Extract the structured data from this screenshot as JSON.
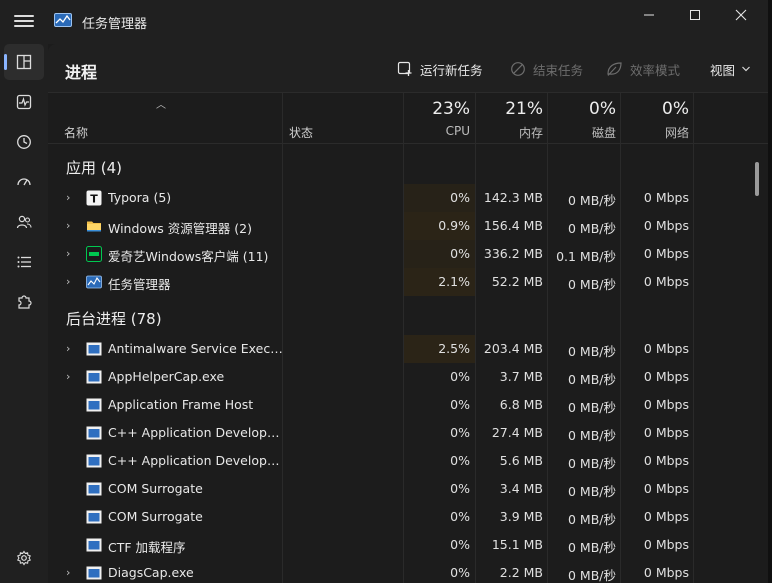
{
  "window": {
    "title": "任务管理器"
  },
  "commands": {
    "page_title": "进程",
    "run_new_task": "运行新任务",
    "end_task": "结束任务",
    "efficiency_mode": "效率模式",
    "view": "视图"
  },
  "columns": {
    "name": "名称",
    "status": "状态",
    "cpu_pct": "23%",
    "cpu_label": "CPU",
    "mem_pct": "21%",
    "mem_label": "内存",
    "disk_pct": "0%",
    "disk_label": "磁盘",
    "net_pct": "0%",
    "net_label": "网络"
  },
  "groups": {
    "apps": {
      "title": "应用 (4)",
      "rows": [
        {
          "name": "Typora (5)",
          "icon": "typora-icon",
          "cpu": "0%",
          "mem": "142.3 MB",
          "disk": "0 MB/秒",
          "net": "0 Mbps"
        },
        {
          "name": "Windows 资源管理器 (2)",
          "icon": "folder-icon",
          "cpu": "0.9%",
          "mem": "156.4 MB",
          "disk": "0 MB/秒",
          "net": "0 Mbps"
        },
        {
          "name": "爱奇艺Windows客户端 (11)",
          "icon": "iqiyi-icon",
          "cpu": "0%",
          "mem": "336.2 MB",
          "disk": "0.1 MB/秒",
          "net": "0 Mbps"
        },
        {
          "name": "任务管理器",
          "icon": "task-manager-icon",
          "cpu": "2.1%",
          "mem": "52.2 MB",
          "disk": "0 MB/秒",
          "net": "0 Mbps"
        }
      ]
    },
    "background": {
      "title": "后台进程 (78)",
      "rows": [
        {
          "name": "Antimalware Service Executable",
          "icon": "process-icon",
          "cpu": "2.5%",
          "mem": "203.4 MB",
          "disk": "0 MB/秒",
          "net": "0 Mbps"
        },
        {
          "name": "AppHelperCap.exe",
          "icon": "process-icon",
          "cpu": "0%",
          "mem": "3.7 MB",
          "disk": "0 MB/秒",
          "net": "0 Mbps"
        },
        {
          "name": "Application Frame Host",
          "icon": "process-icon",
          "cpu": "0%",
          "mem": "6.8 MB",
          "disk": "0 MB/秒",
          "net": "0 Mbps"
        },
        {
          "name": "C++ Application Development",
          "icon": "process-icon",
          "cpu": "0%",
          "mem": "27.4 MB",
          "disk": "0 MB/秒",
          "net": "0 Mbps"
        },
        {
          "name": "C++ Application Development",
          "icon": "process-icon",
          "cpu": "0%",
          "mem": "5.6 MB",
          "disk": "0 MB/秒",
          "net": "0 Mbps"
        },
        {
          "name": "COM Surrogate",
          "icon": "process-icon",
          "cpu": "0%",
          "mem": "3.4 MB",
          "disk": "0 MB/秒",
          "net": "0 Mbps"
        },
        {
          "name": "COM Surrogate",
          "icon": "process-icon",
          "cpu": "0%",
          "mem": "3.9 MB",
          "disk": "0 MB/秒",
          "net": "0 Mbps"
        },
        {
          "name": "CTF 加载程序",
          "icon": "process-icon",
          "cpu": "0%",
          "mem": "15.1 MB",
          "disk": "0 MB/秒",
          "net": "0 Mbps"
        },
        {
          "name": "DiagsCap.exe",
          "icon": "process-icon",
          "cpu": "0%",
          "mem": "2.2 MB",
          "disk": "0 MB/秒",
          "net": "0 Mbps"
        }
      ]
    }
  },
  "colors": {
    "accent": "#8ab4ff",
    "cpu_heat": "#2b2417",
    "panel": "#1c1c1c",
    "chrome": "#202020"
  }
}
